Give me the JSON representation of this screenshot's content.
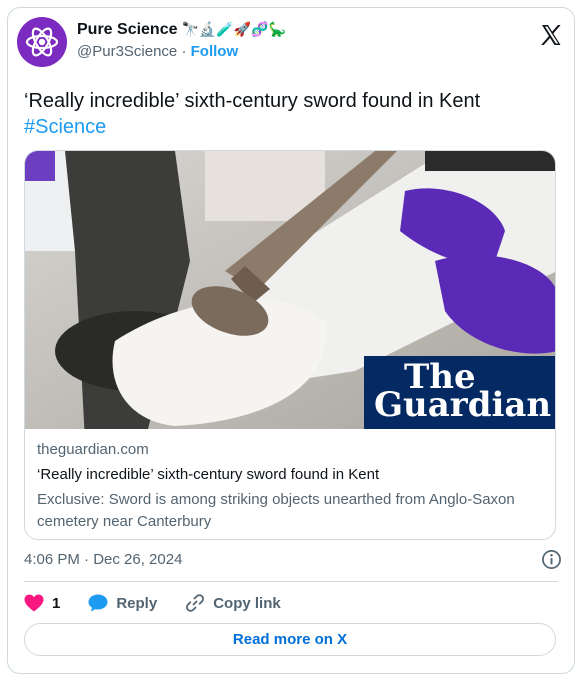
{
  "author": {
    "display_name": "Pure Science",
    "emojis": "🔭🔬🧪🚀🧬🦕",
    "handle": "@Pur3Science",
    "separator": "·",
    "follow_label": "Follow"
  },
  "tweet": {
    "text": "‘Really incredible’ sixth-century sword found in Kent",
    "hashtag": "#Science"
  },
  "link_card": {
    "brand_line1": "The",
    "brand_line2": "Guardian",
    "domain": "theguardian.com",
    "title": "‘Really incredible’ sixth-century sword found in Kent",
    "description": "Exclusive: Sword is among striking objects unearthed from Anglo-Saxon cemetery near Canterbury"
  },
  "timestamp": "4:06 PM · Dec 26, 2024",
  "actions": {
    "likes": "1",
    "reply_label": "Reply",
    "copy_label": "Copy link"
  },
  "read_more_label": "Read more on X",
  "colors": {
    "accent": "#1d9bf0",
    "like": "#f91880",
    "avatar": "#7b2bc0",
    "guardian": "#052962"
  }
}
